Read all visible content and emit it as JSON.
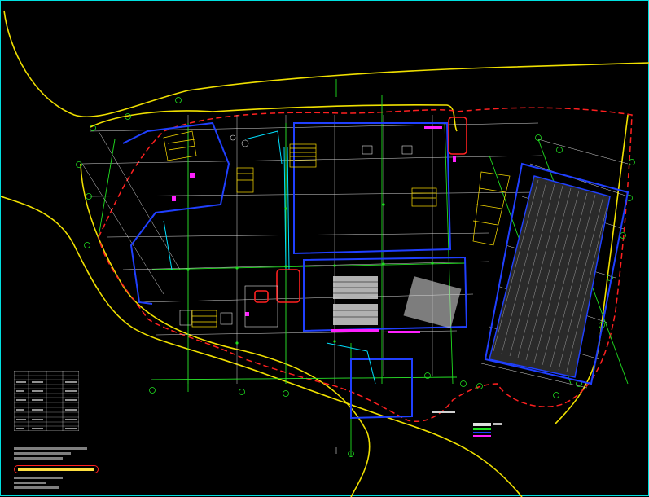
{
  "drawing": {
    "type": "CAD site plan",
    "background": "#000000",
    "frame_color": "#00e0e0",
    "colors": {
      "road_edge": "#f0e000",
      "boundary": "#ff2020",
      "grid": "#20e020",
      "walls": "#2040ff",
      "secondary": "#00e0ff",
      "stairs": "#ffe000",
      "furniture": "#e0e0e0",
      "accent": "#ff20ff",
      "hatch": "#c0c0c0"
    }
  },
  "legend_table": {
    "rows": 13,
    "columns": 4
  },
  "notes": {
    "lines": 7,
    "highlighted_lines": 1
  },
  "key_legend": {
    "items": 4
  }
}
